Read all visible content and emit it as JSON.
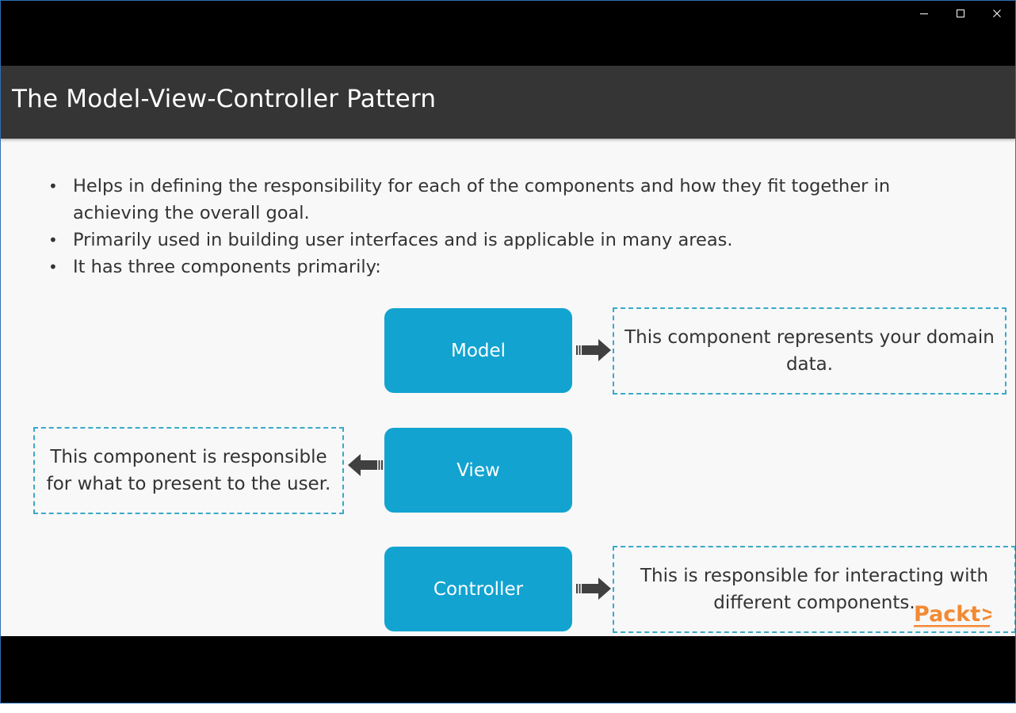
{
  "window": {
    "controls": {
      "minimize_icon": "minimize-icon",
      "maximize_icon": "maximize-icon",
      "close_icon": "close-icon"
    }
  },
  "slide": {
    "title": "The Model-View-Controller Pattern",
    "bullets": [
      "Helps in defining the responsibility for each of the components and how they fit together in achieving the overall goal.",
      "Primarily used in building user interfaces and is applicable in many areas.",
      "It has three components primarily:"
    ],
    "components": {
      "model": {
        "label": "Model",
        "description": "This component represents your domain data."
      },
      "view": {
        "label": "View",
        "description": "This component is responsible for what to present to the user."
      },
      "controller": {
        "label": "Controller",
        "description": "This is responsible for interacting with different components."
      }
    },
    "logo": "Packt>"
  },
  "colors": {
    "title_bar": "#353535",
    "component_fill": "#12a3d0",
    "dashed_border": "#3aa9c8",
    "logo": "#f28a33",
    "arrow": "#404040"
  }
}
